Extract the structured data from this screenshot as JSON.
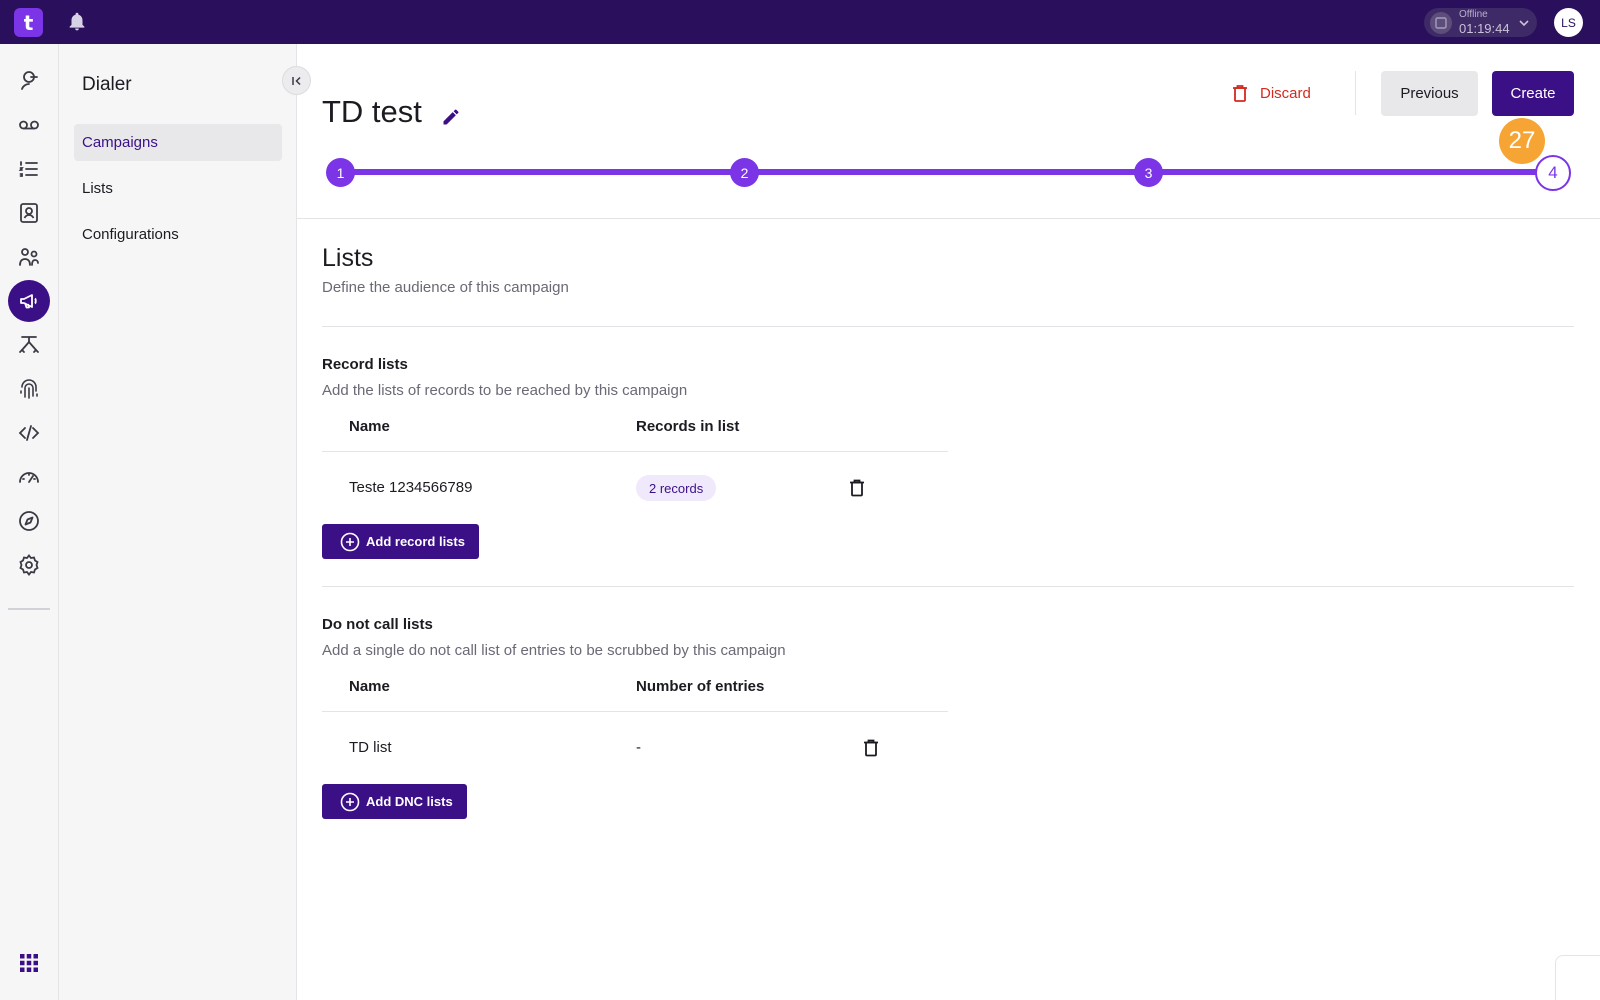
{
  "topbar": {
    "logo_text": "t",
    "status": {
      "label": "Offline",
      "time": "01:19:44"
    },
    "avatar": "LS"
  },
  "rail": {
    "icons": [
      "agent-icon",
      "voicemail-icon",
      "list-icon",
      "contacts-icon",
      "users-icon",
      "megaphone-icon",
      "flow-icon",
      "fingerprint-icon",
      "code-icon",
      "dashboard-icon",
      "compass-icon",
      "gear-icon",
      "apps-grid-icon"
    ],
    "active": "megaphone-icon"
  },
  "subnav": {
    "title": "Dialer",
    "items": [
      {
        "label": "Campaigns",
        "active": true
      },
      {
        "label": "Lists",
        "active": false
      },
      {
        "label": "Configurations",
        "active": false
      }
    ]
  },
  "header": {
    "title": "TD test",
    "discard_label": "Discard",
    "previous_label": "Previous",
    "create_label": "Create",
    "badge": "27"
  },
  "stepper": {
    "steps": [
      "1",
      "2",
      "3",
      "4"
    ],
    "current_step": 4
  },
  "main": {
    "title": "Lists",
    "description": "Define the audience of this campaign",
    "record_lists": {
      "title": "Record lists",
      "description": "Add the lists of records to be reached by this campaign",
      "columns": [
        "Name",
        "Records in list"
      ],
      "rows": [
        {
          "name": "Teste 1234566789",
          "records": "2 records"
        }
      ],
      "add_label": "Add record lists"
    },
    "dnc_lists": {
      "title": "Do not call lists",
      "description": "Add a single do not call list of entries to be scrubbed by this campaign",
      "columns": [
        "Name",
        "Number of entries"
      ],
      "rows": [
        {
          "name": "TD list",
          "entries": "-"
        }
      ],
      "add_label": "Add DNC lists"
    }
  },
  "colors": {
    "topbar": "#2a0f5c",
    "primary": "#3b1087",
    "accent": "#7b35e6",
    "danger": "#d42a1e",
    "badge": "#f6a534"
  }
}
